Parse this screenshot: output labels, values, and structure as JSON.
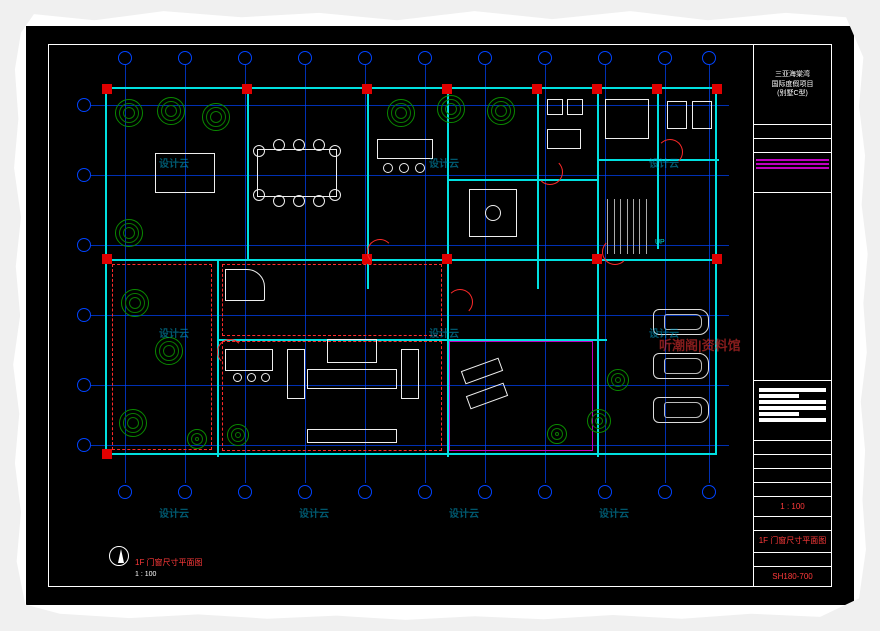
{
  "watermark": "设计云",
  "watermark_red": "听潮阁|资料馆",
  "titleblock": {
    "project_line1": "三亚海棠湾",
    "project_line2": "国际度假项目",
    "project_line3": "(别墅C型)",
    "scale": "1 : 100",
    "drawing_title": "1F 门窗尺寸平面图",
    "sheet_no": "SH180-700"
  },
  "bottom": {
    "scale_label": "1F 门窗尺寸平面图",
    "scale_value": "1 : 100"
  },
  "stair_label": "UP",
  "grid": {
    "vertical_count": 11,
    "horizontal_count": 6
  },
  "color_scheme": {
    "walls": "#00e0e0",
    "grid": "#0044ff",
    "doors": "#ff2a2a",
    "columns": "#e00000",
    "landscape": "#0a8a00",
    "accent": "#c000c0"
  }
}
